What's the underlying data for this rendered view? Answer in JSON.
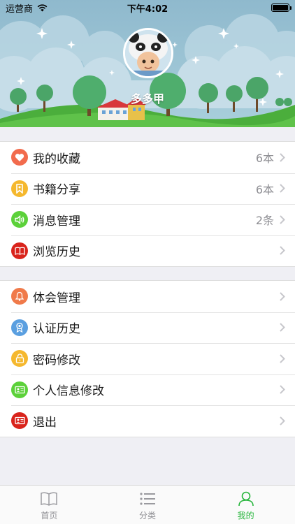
{
  "status_bar": {
    "carrier": "运营商",
    "time": "下午4:02",
    "battery_level": 1.0
  },
  "profile": {
    "username": "多多甲"
  },
  "menu_group_1": [
    {
      "label": "我的收藏",
      "value": "6本",
      "icon": "heart-icon",
      "color": "#f26b4d"
    },
    {
      "label": "书籍分享",
      "value": "6本",
      "icon": "bookmark-icon",
      "color": "#f5b82e"
    },
    {
      "label": "消息管理",
      "value": "2条",
      "icon": "speaker-icon",
      "color": "#5cd13a"
    },
    {
      "label": "浏览历史",
      "value": "",
      "icon": "open-book-icon",
      "color": "#d9241c"
    }
  ],
  "menu_group_2": [
    {
      "label": "体会管理",
      "value": "",
      "icon": "bell-icon",
      "color": "#f07a4a"
    },
    {
      "label": "认证历史",
      "value": "",
      "icon": "award-icon",
      "color": "#5a9fe0"
    },
    {
      "label": "密码修改",
      "value": "",
      "icon": "lock-icon",
      "color": "#f5b82e"
    },
    {
      "label": "个人信息修改",
      "value": "",
      "icon": "id-card-icon",
      "color": "#5cd13a"
    },
    {
      "label": "退出",
      "value": "",
      "icon": "exit-card-icon",
      "color": "#d9241c"
    }
  ],
  "tabbar": {
    "tabs": [
      {
        "label": "首页",
        "icon": "book-icon",
        "active": false
      },
      {
        "label": "分类",
        "icon": "list-icon",
        "active": false
      },
      {
        "label": "我的",
        "icon": "person-icon",
        "active": true
      }
    ],
    "active_color": "#26b53b",
    "inactive_color": "#8e8e93"
  }
}
